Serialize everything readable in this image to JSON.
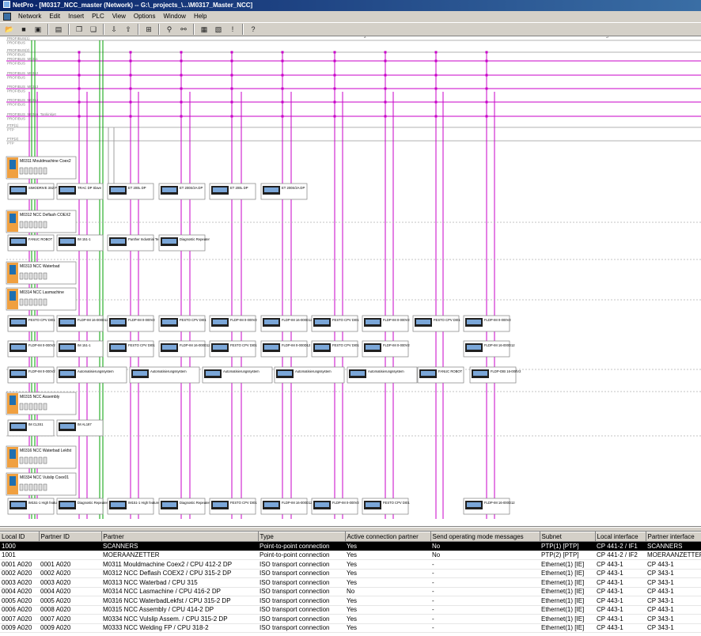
{
  "window": {
    "title": "NetPro - [M0317_NCC_master (Network) -- G:\\_projects_\\...\\M0317_Master_NCC]"
  },
  "menu": [
    "Network",
    "Edit",
    "Insert",
    "PLC",
    "View",
    "Options",
    "Window",
    "Help"
  ],
  "toolbar": {
    "icons": [
      "open-icon",
      "save-icon",
      "save-compile-icon",
      "print-icon",
      "copy-icon",
      "paste-icon",
      "download-icon",
      "upload-icon",
      "network-icon",
      "zoom-icon",
      "link-icon",
      "config-icon",
      "module-icon",
      "warning-icon",
      "help-icon"
    ]
  },
  "ruler": {
    "marks": [
      "2",
      "3"
    ]
  },
  "subnets": [
    {
      "label": "PROFIBUS(1)",
      "sublabel": "PROFIBUS",
      "color": "#b0b0b0"
    },
    {
      "label": "PROFIBUS(2)",
      "sublabel": "PROFIBUS",
      "color": "#b0b0b0"
    },
    {
      "label": "PROFIBUS_M0311",
      "sublabel": "PROFIBUS",
      "color": "#c800c8"
    },
    {
      "label": "PROFIBUS_M0312",
      "sublabel": "PROFIBUS",
      "color": "#c800c8"
    },
    {
      "label": "PROFIBUS_M0313",
      "sublabel": "PROFIBUS",
      "color": "#c800c8"
    },
    {
      "label": "PROFIBUS_M0314",
      "sublabel": "PROFIBUS",
      "color": "#c800c8"
    },
    {
      "label": "PROFIBUS_M0316_Tankinkjet",
      "sublabel": "PROFIBUS",
      "color": "#c800c8"
    },
    {
      "label": "PTP(1)",
      "sublabel": "PTP",
      "color": "#b0b0b0"
    },
    {
      "label": "PTP(2)",
      "sublabel": "PTP",
      "color": "#b0b0b0"
    }
  ],
  "stations": [
    {
      "name": "M0311 Mouldmachine Coex2"
    },
    {
      "name": "M0312 NCC Deflash COEX2"
    },
    {
      "name": "M0313 NCC Waterbad"
    },
    {
      "name": "M0314 NCC Lasmachine"
    },
    {
      "name": "M0315 NCC Assembly"
    },
    {
      "name": "M0316 NCC Waterbad Lekfst"
    },
    {
      "name": "M0334 NCC Vulslip Coex01"
    }
  ],
  "device_rows": [
    [
      "SIMODRIVE 3S2 PROFIDRIVE",
      "TRAC DP Slave",
      "ET 200L DP",
      "ET 200S/2A DP",
      "ET 200L DP",
      "ET 200S/2A DP"
    ],
    [
      "FANUC ROBOT",
      "IM 151-1",
      "Panther Industrial Term",
      "Diagnostic Repeater"
    ],
    [
      "FESTO CPV DI01",
      "FLDP-IM 16-000D12",
      "FLDP-IM 0-000V2",
      "FESTO CPV DI01",
      "FLDP-IM 0-000V2",
      "FLDP-IM 16-000D12",
      "FESTO CPV DI01",
      "FLDP-IM 0-000V2",
      "FESTO CPV DI01",
      "FLDP-IM 0-000V2"
    ],
    [
      "FLDP-IM 0-000V2",
      "IM 151-1",
      "FESTO CPV DI01",
      "FLDP-IM 16-000D12",
      "FESTO CPV DI01",
      "FLDP-IM 0-000D12",
      "FESTO CPV DI01",
      "FLDP-IM 0-000V2",
      "FLDP-IM 16-000D12"
    ],
    [
      "FLDP-IM 0-000V2",
      "Automatisierungssystem",
      "Automatisierungssystem",
      "Automatisierungssystem",
      "Automatisierungssystem",
      "Automatisierungssystem",
      "FANUC ROBOT",
      "FLDP-DIB 16-000V2"
    ],
    [
      "IM CL3S1",
      "IM AL187"
    ],
    [
      "IM151-1 High feature",
      "Diagnostic Repeater",
      "IM151-1 High feature",
      "Diagnostic Repeater",
      "FESTO CPV DI01",
      "FLDP-IM 16-000D12",
      "FLDP-IM 0-000V2",
      "FESTO CPV DI01",
      "FLDP-IM 16-000D12"
    ]
  ],
  "connections_table": {
    "headers": [
      "Local ID",
      "Partner ID",
      "Partner",
      "Type",
      "Active connection partner",
      "Send operating mode messages",
      "Subnet",
      "Local interface",
      "Partner interface"
    ],
    "rows": [
      [
        "1000",
        "",
        "SCANNERS",
        "Point-to-point connection",
        "Yes",
        "No",
        "PTP(1) [PTP]",
        "CP 441-2 / IF1",
        "SCANNERS"
      ],
      [
        "1001",
        "",
        "MOERAANZETTER",
        "Point-to-point connection",
        "Yes",
        "No",
        "PTP(2) [PTP]",
        "CP 441-2 / IF2",
        "MOERAANZETTER"
      ],
      [
        "0001 A020",
        "0001 A020",
        "M0311 Mouldmachine Coex2 / CPU 412-2 DP",
        "ISO transport connection",
        "Yes",
        "-",
        "Ethernet(1) [IE]",
        "CP 443-1",
        "CP 443-1"
      ],
      [
        "0002 A020",
        "0002 A020",
        "M0312 NCC Deflash COEX2 / CPU 315-2 DP",
        "ISO transport connection",
        "Yes",
        "-",
        "Ethernet(1) [IE]",
        "CP 443-1",
        "CP 343-1"
      ],
      [
        "0003 A020",
        "0003 A020",
        "M0313 NCC Waterbad / CPU 315",
        "ISO transport connection",
        "Yes",
        "-",
        "Ethernet(1) [IE]",
        "CP 443-1",
        "CP 343-1"
      ],
      [
        "0004 A020",
        "0004 A020",
        "M0314 NCC Lasmachine / CPU 416-2 DP",
        "ISO transport connection",
        "No",
        "-",
        "Ethernet(1) [IE]",
        "CP 443-1",
        "CP 443-1"
      ],
      [
        "0005 A020",
        "0005 A020",
        "M0316 NCC WaterbadLekfst / CPU 315-2 DP",
        "ISO transport connection",
        "Yes",
        "-",
        "Ethernet(1) [IE]",
        "CP 443-1",
        "CP 343-1"
      ],
      [
        "0006 A020",
        "0008 A020",
        "M0315 NCC Assembly / CPU 414-2 DP",
        "ISO transport connection",
        "Yes",
        "-",
        "Ethernet(1) [IE]",
        "CP 443-1",
        "CP 443-1"
      ],
      [
        "0007 A020",
        "0007 A020",
        "M0334 NCC Vulslip Assem. / CPU 315-2 DP",
        "ISO transport connection",
        "Yes",
        "-",
        "Ethernet(1) [IE]",
        "CP 443-1",
        "CP 343-1"
      ],
      [
        "0009 A020",
        "0009 A020",
        "M0333 NCC Welding FP / CPU 318-2",
        "ISO transport connection",
        "Yes",
        "-",
        "Ethernet(1) [IE]",
        "CP 443-1",
        "CP 343-1"
      ]
    ],
    "selected_row": 0
  },
  "colors": {
    "profibus": "#c800c8",
    "ethernet": "#00a000",
    "ptp": "#a0a0a0",
    "station": "#f0a040",
    "selection": "#000000"
  }
}
